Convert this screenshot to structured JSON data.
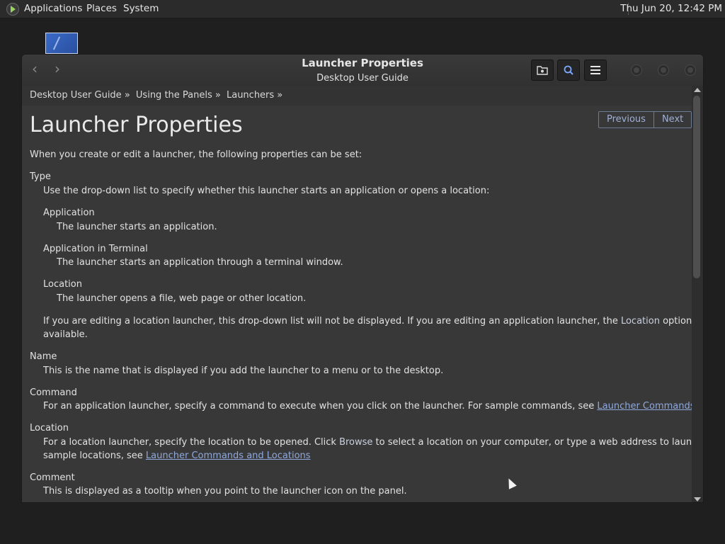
{
  "top_panel": {
    "menus": [
      "Applications",
      "Places",
      "System"
    ],
    "clock": "Thu Jun 20, 12:42 PM"
  },
  "window": {
    "title": "Launcher Properties",
    "subtitle": "Desktop User Guide",
    "icons": {
      "back": "chevron-left-icon",
      "forward": "chevron-right-icon",
      "open": "folder-icon",
      "search": "search-icon",
      "menu": "hamburger-menu-icon"
    }
  },
  "breadcrumb": [
    "Desktop User Guide »",
    "Using the Panels »",
    "Launchers »"
  ],
  "page": {
    "title": "Launcher Properties",
    "pager": {
      "previous": "Previous",
      "next": "Next"
    },
    "intro": "When you create or edit a launcher, the following properties can be set:",
    "type_term": "Type",
    "type_desc": "Use the drop-down list to specify whether this launcher starts an application or opens a location:",
    "app_term": "Application",
    "app_desc": "The launcher starts an application.",
    "appterm_term": "Application in Terminal",
    "appterm_desc": "The launcher starts an application through a terminal window.",
    "location_term": "Location",
    "location_desc": "The launcher opens a file, web page or other location.",
    "note_line1_a": "If you are editing a location launcher, this drop-down list will not be displayed. If you are editing an application launcher, the ",
    "note_line1_gui": "Location",
    "note_line1_b": " option will not be",
    "note_line2": "available.",
    "name_term": "Name",
    "name_desc": "This is the name that is displayed if you add the launcher to a menu or to the desktop.",
    "command_term": "Command",
    "command_desc": "For an application launcher, specify a command to execute when you click on the launcher. For sample commands, see ",
    "command_link": "Launcher Commands and Locations",
    "command_end": ".",
    "loc_term": "Location",
    "loc_desc_a": "For a location launcher, specify the location to be opened. Click ",
    "loc_desc_gui": "Browse",
    "loc_desc_b": " to select a location on your computer, or type a web address to launch a web page. For",
    "loc_desc2": "sample locations, see ",
    "loc_link": "Launcher Commands and Locations",
    "comment_term": "Comment",
    "comment_desc": "This is displayed as a tooltip when you point to the launcher icon on the panel."
  }
}
